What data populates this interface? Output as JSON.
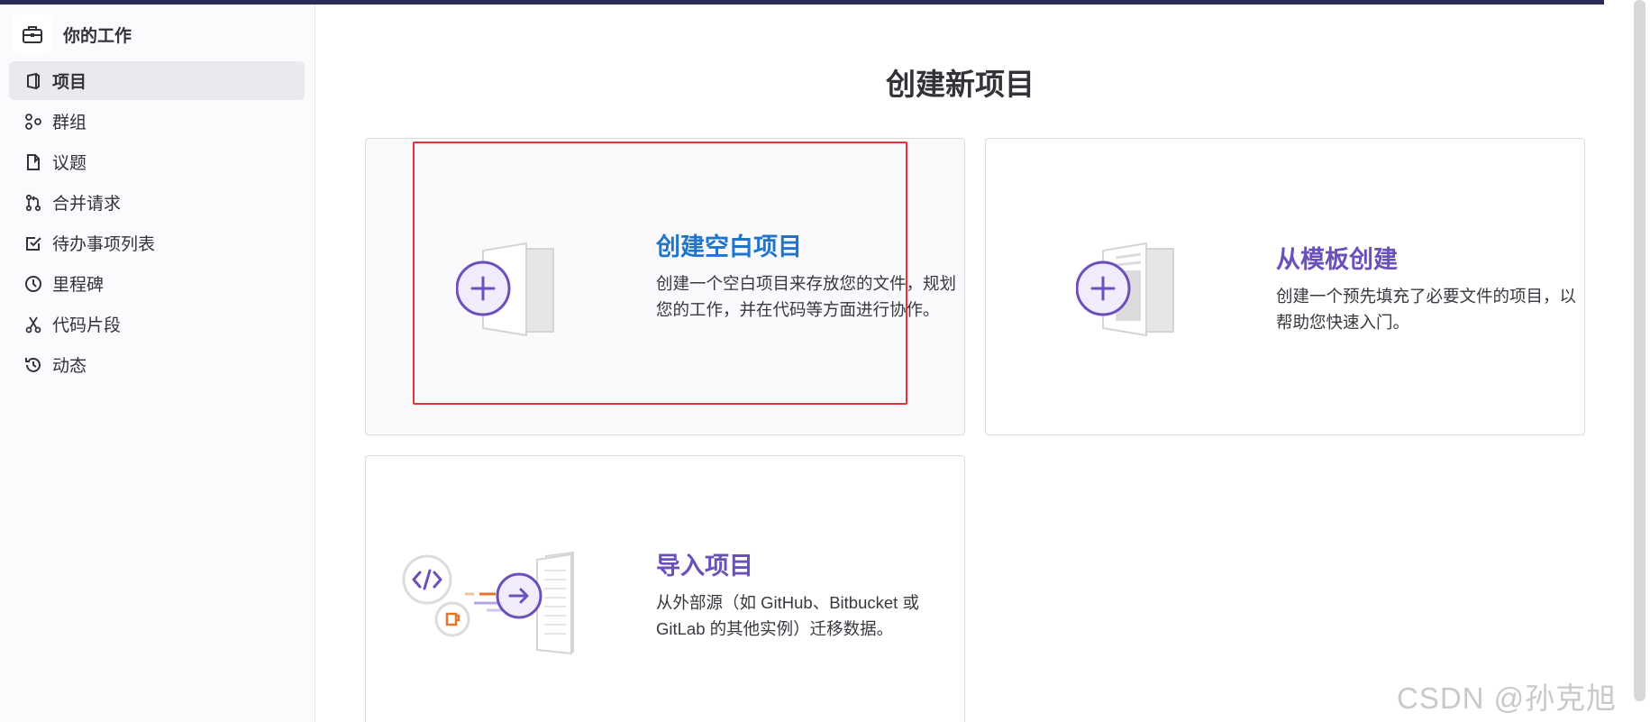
{
  "sidebar": {
    "title": "你的工作",
    "items": [
      {
        "label": "项目",
        "icon": "project-icon",
        "active": true
      },
      {
        "label": "群组",
        "icon": "group-icon",
        "active": false
      },
      {
        "label": "议题",
        "icon": "issues-icon",
        "active": false
      },
      {
        "label": "合并请求",
        "icon": "merge-request-icon",
        "active": false
      },
      {
        "label": "待办事项列表",
        "icon": "todo-checkbox-icon",
        "active": false
      },
      {
        "label": "里程碑",
        "icon": "milestone-clock-icon",
        "active": false
      },
      {
        "label": "代码片段",
        "icon": "snippet-scissors-icon",
        "active": false
      },
      {
        "label": "动态",
        "icon": "activity-history-icon",
        "active": false
      }
    ]
  },
  "main": {
    "title": "创建新项目",
    "cards": [
      {
        "title": "创建空白项目",
        "description": "创建一个空白项目来存放您的文件，规划您的工作，并在代码等方面进行协作。",
        "title_color": "#1f75cb"
      },
      {
        "title": "从模板创建",
        "description": "创建一个预先填充了必要文件的项目，以帮助您快速入门。",
        "title_color": "#6b4fbb"
      },
      {
        "title": "导入项目",
        "description": "从外部源（如 GitHub、Bitbucket 或 GitLab 的其他实例）迁移数据。",
        "title_color": "#6b4fbb"
      }
    ]
  },
  "watermark": "CSDN @孙克旭",
  "colors": {
    "accent_purple": "#6b4fbb",
    "link_blue": "#1f75cb",
    "highlight_red": "#e5313a",
    "orange": "#e2762f"
  }
}
